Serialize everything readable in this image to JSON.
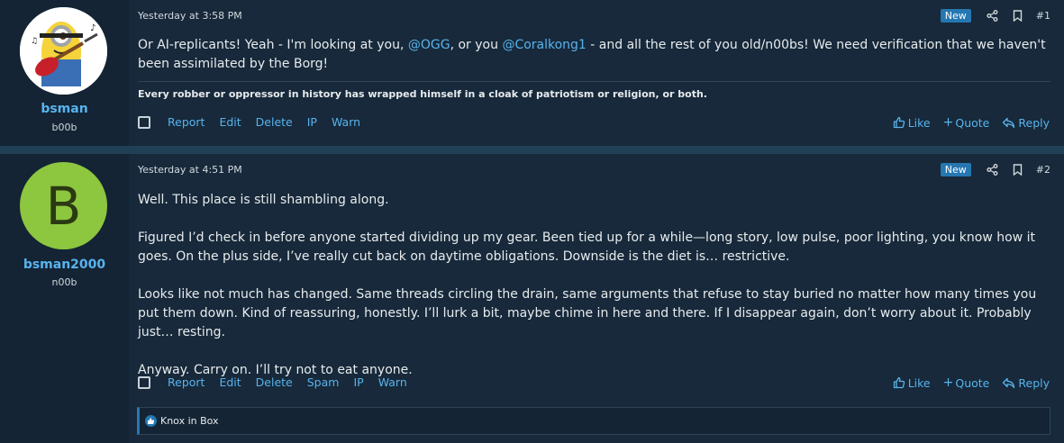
{
  "posts": [
    {
      "username": "bsman",
      "user_title": "b00b",
      "avatar_icon": "minion-guitar-avatar",
      "date": "Yesterday at 3:58 PM",
      "badge": "New",
      "post_number": "#1",
      "message": {
        "part1": "Or AI-replicants! Yeah - I'm looking at you, ",
        "mention1": "@OGG",
        "part2": ", or you ",
        "mention2": "@Coralkong1",
        "part3": " - and all the rest of you old/n00bs! We need verification that we haven't been assimilated by the Borg!"
      },
      "signature": "Every robber or oppressor in history has wrapped himself in a cloak of patriotism or religion, or both.",
      "actions": [
        "Report",
        "Edit",
        "Delete",
        "IP",
        "Warn"
      ],
      "reactions": {
        "like": "Like",
        "quote": "Quote",
        "reply": "Reply"
      }
    },
    {
      "username": "bsman2000",
      "user_title": "n00b",
      "avatar_letter": "B",
      "date": "Yesterday at 4:51 PM",
      "badge": "New",
      "post_number": "#2",
      "paragraphs": [
        "Well. This place is still shambling along.",
        "Figured I’d check in before anyone started dividing up my gear. Been tied up for a while—long story, low pulse, poor lighting, you know how it goes. On the plus side, I’ve really cut back on daytime obligations. Downside is the diet is… restrictive.",
        "Looks like not much has changed. Same threads circling the drain, same arguments that refuse to stay buried no matter how many times you put them down. Kind of reassuring, honestly. I’ll lurk a bit, maybe chime in here and there. If I disappear again, don’t worry about it. Probably just… resting.",
        "Anyway. Carry on. I’ll try not to eat anyone."
      ],
      "actions": [
        "Report",
        "Edit",
        "Delete",
        "Spam",
        "IP",
        "Warn"
      ],
      "reactions": {
        "like": "Like",
        "quote": "Quote",
        "reply": "Reply"
      },
      "reaction_summary": "Knox in Box"
    }
  ],
  "colors": {
    "background": "#17293a",
    "user_column": "#142434",
    "link": "#58b3ee",
    "badge": "#2577b1",
    "avatar_green": "#8dc63f"
  }
}
